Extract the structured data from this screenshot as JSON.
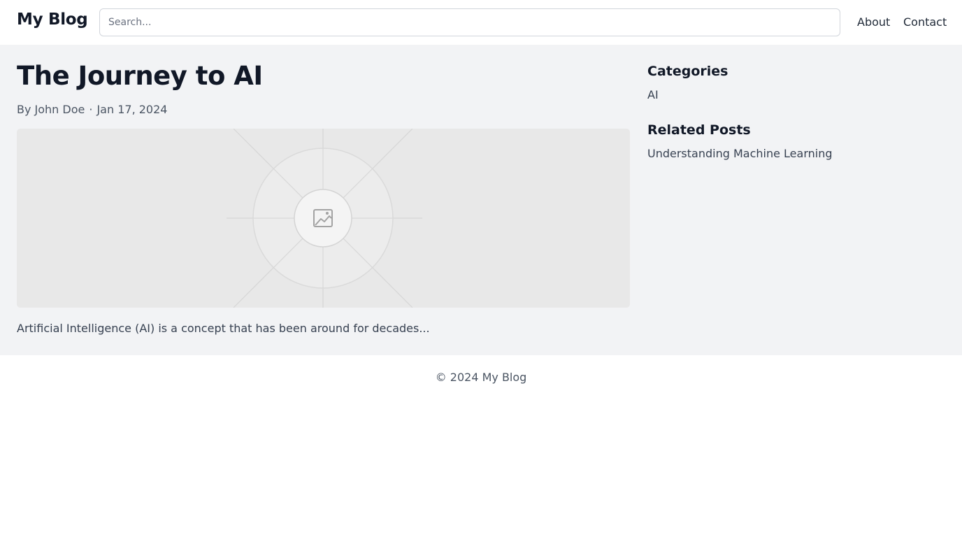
{
  "header": {
    "logo": "My Blog",
    "search": {
      "placeholder": "Search...",
      "value": ""
    },
    "nav": {
      "about": "About",
      "contact": "Contact"
    }
  },
  "post": {
    "title": "The Journey to AI",
    "author": "By John Doe",
    "separator": "·",
    "date": "Jan 17, 2024",
    "image_icon": "image-icon",
    "excerpt": "Artificial Intelligence (AI) is a concept that has been around for decades..."
  },
  "sidebar": {
    "categories": {
      "heading": "Categories",
      "items": [
        "AI"
      ]
    },
    "related": {
      "heading": "Related Posts",
      "items": [
        "Understanding Machine Learning"
      ]
    }
  },
  "footer": {
    "text": "© 2024 My Blog"
  },
  "colors": {
    "main_background": "#f2f3f5",
    "placeholder_background": "#e8e8e8",
    "heading_text": "#111827",
    "muted_text": "#4b5563"
  }
}
